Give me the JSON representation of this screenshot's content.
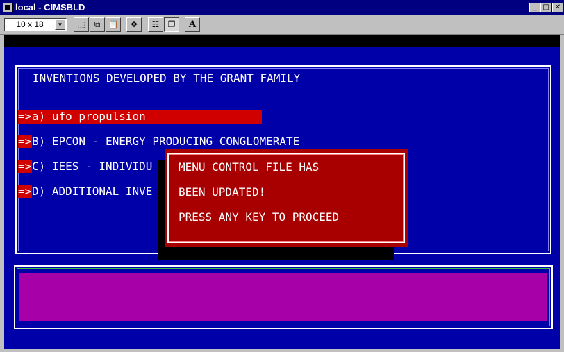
{
  "window": {
    "title": "local - CIMSBLD",
    "min_glyph": "_",
    "max_glyph": "□",
    "close_glyph": "✕"
  },
  "toolbar": {
    "font_size": "10 x 18",
    "dropdown_glyph": "▼",
    "buttons": [
      {
        "icon": "mark-icon",
        "glyph": "⬚"
      },
      {
        "icon": "copy-icon",
        "glyph": "⧉"
      },
      {
        "icon": "paste-icon",
        "glyph": "📋"
      },
      {
        "icon": "fullscreen-icon",
        "glyph": "✥"
      },
      {
        "icon": "properties-icon",
        "glyph": "☷"
      },
      {
        "icon": "background-icon",
        "glyph": "❐"
      },
      {
        "icon": "font-icon",
        "glyph": "A"
      }
    ]
  },
  "screen": {
    "heading": "INVENTIONS DEVELOPED BY THE GRANT FAMILY",
    "arrow": "=>",
    "menu": [
      {
        "label": "a) ufo propulsion",
        "selected": true
      },
      {
        "label": "B) EPCON - ENERGY PRODUCING CONGLOMERATE"
      },
      {
        "label": "C) IEES - INDIVIDU"
      },
      {
        "label": "D) ADDITIONAL INVE"
      }
    ],
    "popup": {
      "line1": "MENU CONTROL FILE HAS",
      "line2": "BEEN UPDATED!",
      "line3": "PRESS ANY KEY TO PROCEED"
    }
  },
  "colors": {
    "background": "#0000a8",
    "highlight": "#d00000",
    "popup": "#a80000",
    "status_fill": "#a800a8"
  }
}
